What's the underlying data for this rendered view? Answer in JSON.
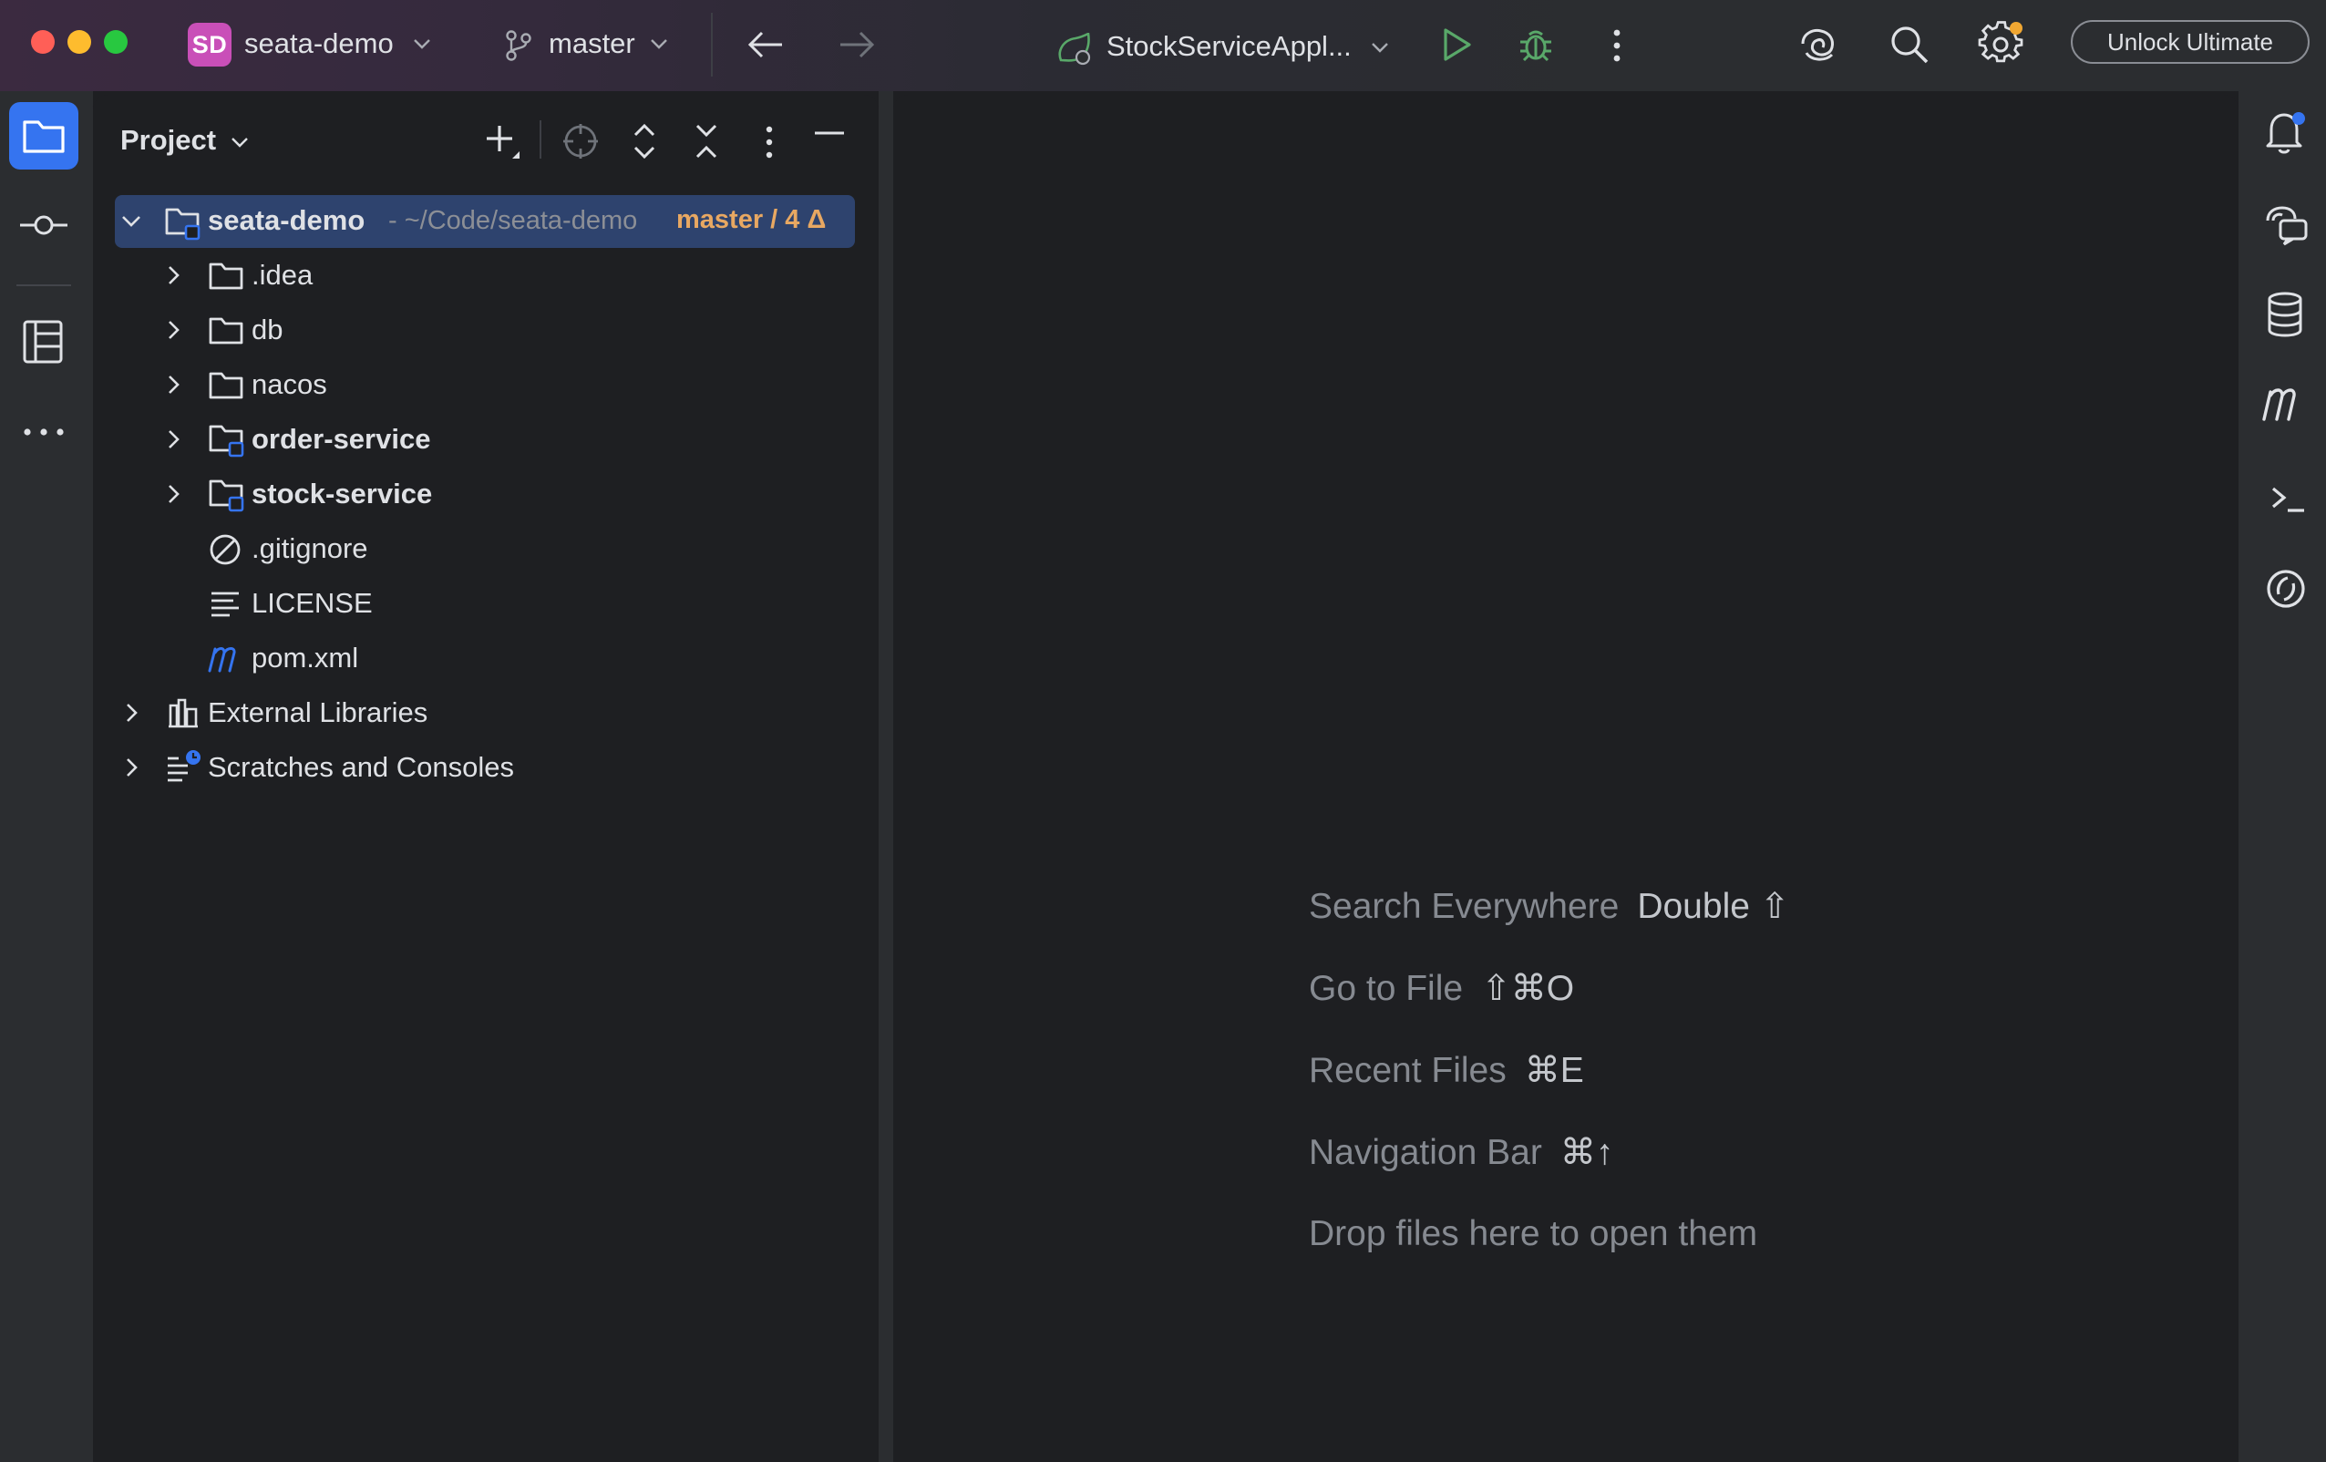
{
  "titlebar": {
    "project_badge": "SD",
    "project_name": "seata-demo",
    "branch": "master",
    "run_config": "StockServiceAppl...",
    "unlock_label": "Unlock Ultimate",
    "icons": [
      "project-chevron-icon",
      "branch-icon",
      "branch-chevron-icon",
      "back-arrow-icon",
      "forward-arrow-icon",
      "spring-run-icon",
      "run-config-chevron-icon",
      "run-icon",
      "debug-icon",
      "more-vertical-icon",
      "ai-assistant-icon",
      "search-icon",
      "settings-icon"
    ]
  },
  "left_strip": {
    "icons": [
      "project-folder-icon",
      "commit-icon",
      "structure-icon",
      "more-tools-icon"
    ]
  },
  "project_panel": {
    "title": "Project",
    "toolbar_icons": [
      "new-file-icon",
      "locate-icon",
      "expand-all-icon",
      "collapse-all-icon",
      "options-icon",
      "hide-panel-icon"
    ],
    "root": {
      "name": "seata-demo",
      "path": "- ~/Code/seata-demo",
      "branch_info": "master / 4 Δ"
    },
    "items": [
      {
        "label": ".idea"
      },
      {
        "label": "db"
      },
      {
        "label": "nacos"
      },
      {
        "label": "order-service"
      },
      {
        "label": "stock-service"
      },
      {
        "label": ".gitignore"
      },
      {
        "label": "LICENSE"
      },
      {
        "label": "pom.xml"
      },
      {
        "label": "External Libraries"
      },
      {
        "label": "Scratches and Consoles"
      }
    ]
  },
  "editor": {
    "hints": [
      {
        "label": "Search Everywhere",
        "key": "Double ⇧"
      },
      {
        "label": "Go to File",
        "key": "⇧⌘O"
      },
      {
        "label": "Recent Files",
        "key": "⌘E"
      },
      {
        "label": "Navigation Bar",
        "key": "⌘↑"
      },
      {
        "label": "Drop files here to open them",
        "key": ""
      }
    ]
  },
  "right_strip": {
    "icons": [
      "notifications-icon",
      "ai-chat-icon",
      "database-icon",
      "maven-icon",
      "terminal-icon",
      "copilot-icon"
    ]
  },
  "colors": {
    "accent": "#3574f0",
    "selection": "#2e436e",
    "branch_highlight": "#e8a862",
    "run_green": "#59a869",
    "badge": "#c94fb8"
  }
}
